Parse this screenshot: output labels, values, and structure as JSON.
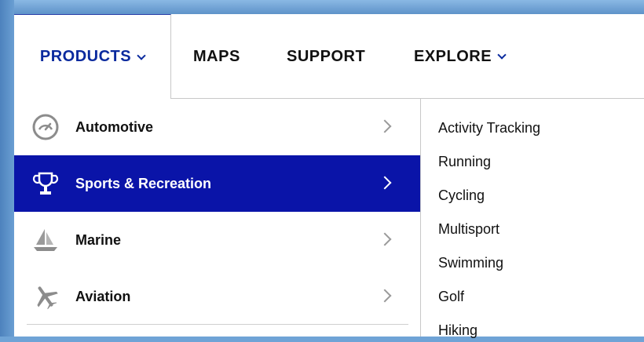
{
  "topnav": {
    "items": [
      {
        "label": "PRODUCTS",
        "active": true,
        "dropdown": true
      },
      {
        "label": "MAPS"
      },
      {
        "label": "SUPPORT"
      },
      {
        "label": "EXPLORE",
        "dropdown": true
      }
    ]
  },
  "categories": [
    {
      "label": "Automotive",
      "icon": "speedometer-icon"
    },
    {
      "label": "Sports & Recreation",
      "icon": "trophy-icon",
      "active": true
    },
    {
      "label": "Marine",
      "icon": "sailboat-icon"
    },
    {
      "label": "Aviation",
      "icon": "airplane-icon"
    }
  ],
  "subcategories": [
    "Activity Tracking",
    "Running",
    "Cycling",
    "Multisport",
    "Swimming",
    "Golf",
    "Hiking"
  ],
  "colors": {
    "accent": "#0a14a8",
    "nav_active_text": "#0a2a9e"
  }
}
